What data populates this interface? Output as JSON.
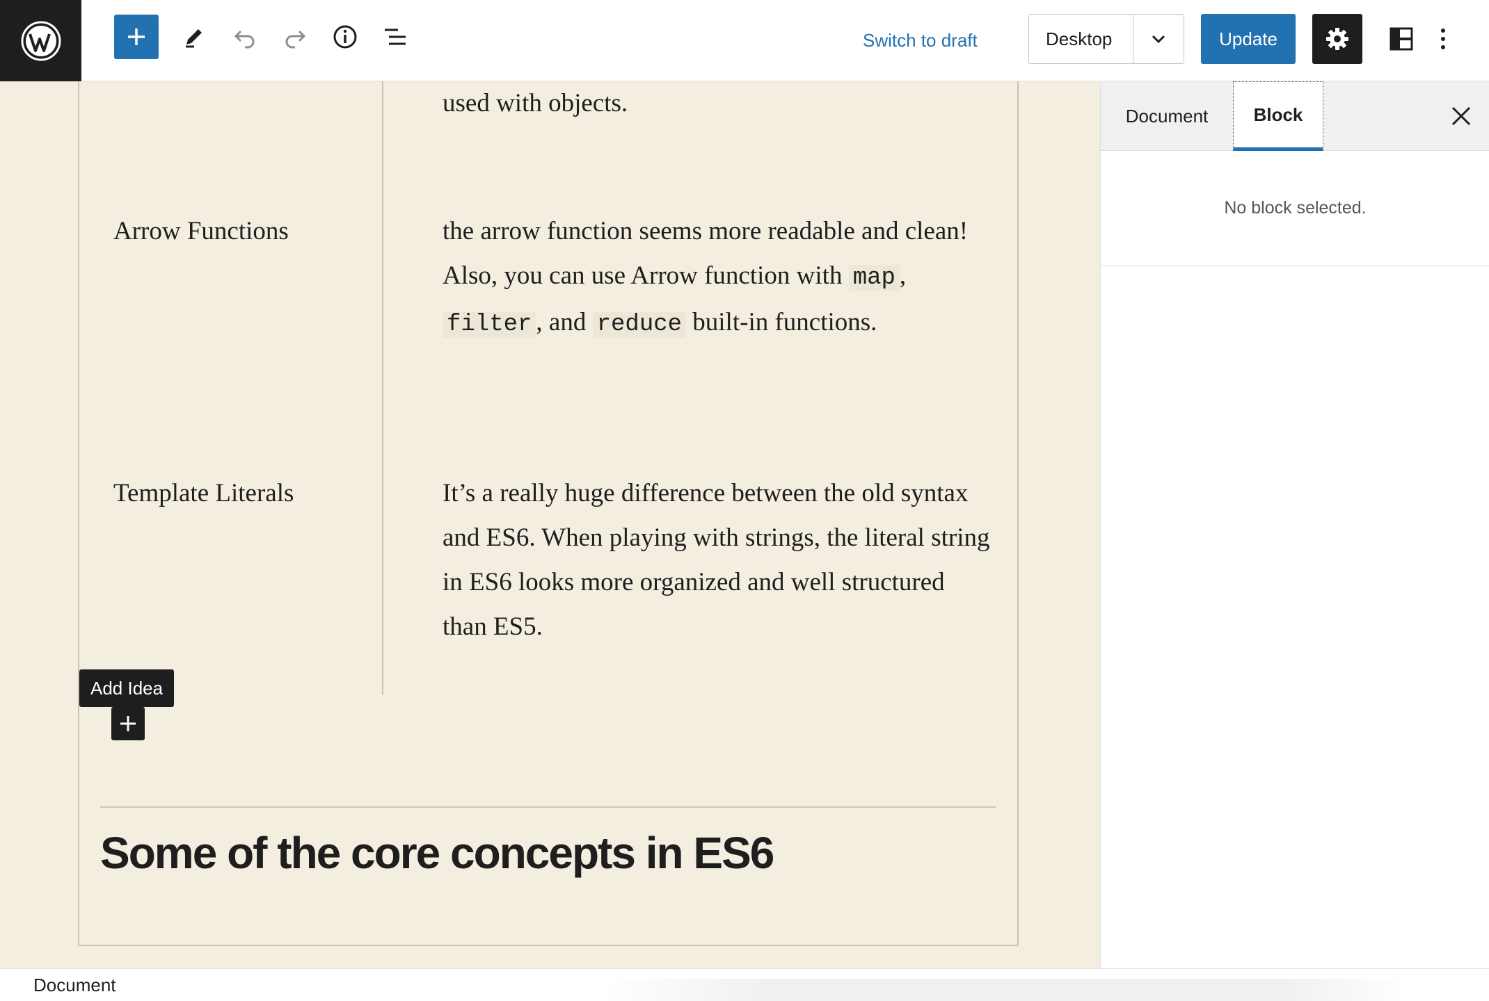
{
  "toolbar": {
    "logo_icon": "wordpress-logo",
    "inserter_icon": "plus-icon",
    "edit_icon": "pencil-icon",
    "undo_icon": "undo-icon",
    "redo_icon": "redo-icon",
    "info_icon": "info-icon",
    "list_view_icon": "list-view-icon",
    "switch_to_draft": "Switch to draft",
    "preview_device": "Desktop",
    "update_label": "Update",
    "settings_icon": "gear-icon",
    "layout_icon": "layout-icon",
    "more_icon": "more-vertical-icon"
  },
  "colors": {
    "accent": "#2271b1",
    "dark": "#1e1e1e",
    "canvas_bg": "#f3eedf"
  },
  "editor": {
    "top_fragment": "used with objects.",
    "rows": [
      {
        "label": "Arrow Functions",
        "text_parts": {
          "a": "the arrow function seems more readable and clean! Also, you can use Arrow function with ",
          "code1": "map",
          "sep1": ", ",
          "code2": "filter",
          "sep2": ", and ",
          "code3": "reduce",
          "b": " built-in functions."
        }
      },
      {
        "label": "Template Literals",
        "text": "It’s a really huge difference between the old syntax and ES6. When playing with strings, the literal string in ES6 looks more organized and well structured than ES5."
      }
    ],
    "tooltip": "Add Idea",
    "heading": "Some of the core concepts in ES6"
  },
  "sidebar": {
    "tabs": [
      "Document",
      "Block"
    ],
    "active_tab": "Block",
    "empty_message": "No block selected.",
    "close_icon": "close-icon"
  },
  "footer": {
    "breadcrumb": "Document"
  }
}
